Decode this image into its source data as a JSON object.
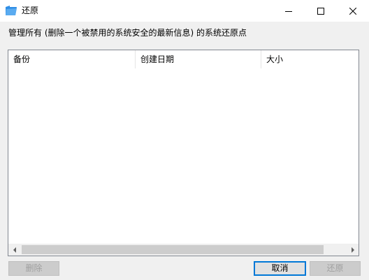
{
  "window": {
    "title": "还原",
    "icon": "folder-icon"
  },
  "description": "管理所有 (删除一个被禁用的系统安全的最新信息) 的系统还原点",
  "listview": {
    "columns": [
      "备份",
      "创建日期",
      "大小"
    ],
    "rows": []
  },
  "buttons": {
    "delete": "删除",
    "cancel": "取消",
    "restore": "还原"
  },
  "colors": {
    "accent": "#0078d7",
    "icon_blue": "#1e88e5"
  }
}
